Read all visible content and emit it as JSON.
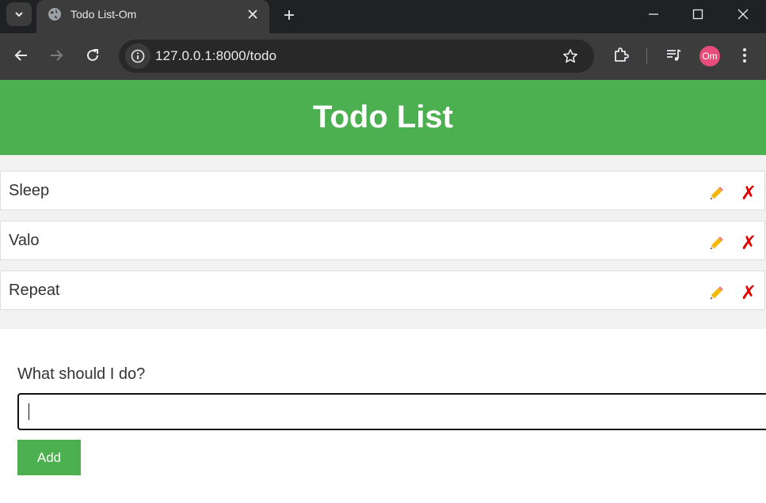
{
  "browser": {
    "tab_title": "Todo List-Om",
    "url": "127.0.0.1:8000/todo",
    "profile_initials": "Om"
  },
  "page": {
    "title": "Todo List",
    "todos": [
      {
        "text": "Sleep"
      },
      {
        "text": "Valo"
      },
      {
        "text": "Repeat"
      }
    ],
    "delete_glyph": "✗",
    "form_label": "What should I do?",
    "input_value": "",
    "add_label": "Add"
  },
  "colors": {
    "header_bg": "#4caf50",
    "button_bg": "#4caf50",
    "delete_color": "#e10000",
    "edit_color": "#f5b800",
    "list_bg": "#f2f2f2"
  },
  "icons": [
    "tab-search-icon",
    "globe-icon",
    "close-icon",
    "plus-icon",
    "minimize-icon",
    "maximize-icon",
    "back-icon",
    "forward-icon",
    "reload-icon",
    "site-info-icon",
    "star-icon",
    "extensions-icon",
    "media-icon",
    "menu-icon",
    "pencil-icon"
  ]
}
